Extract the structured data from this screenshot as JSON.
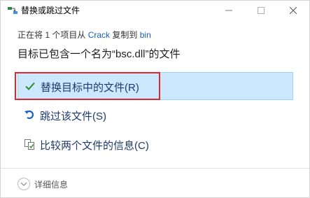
{
  "window": {
    "title": "替换或跳过文件"
  },
  "status": {
    "prefix": "正在将 1 个项目从",
    "source": "Crack",
    "middle": "复制到",
    "destination": "bin"
  },
  "headline": "目标已包含一个名为“bsc.dll”的文件",
  "options": {
    "replace": "替换目标中的文件(R)",
    "skip": "跳过该文件(S)",
    "compare": "比较两个文件的信息(C)"
  },
  "footer": {
    "details_label": "详细信息"
  },
  "colors": {
    "selected_bg": "#cce8ff",
    "highlight_border": "#e0262f",
    "check_green": "#2e8b2e",
    "link_blue": "#1a5fb4"
  }
}
